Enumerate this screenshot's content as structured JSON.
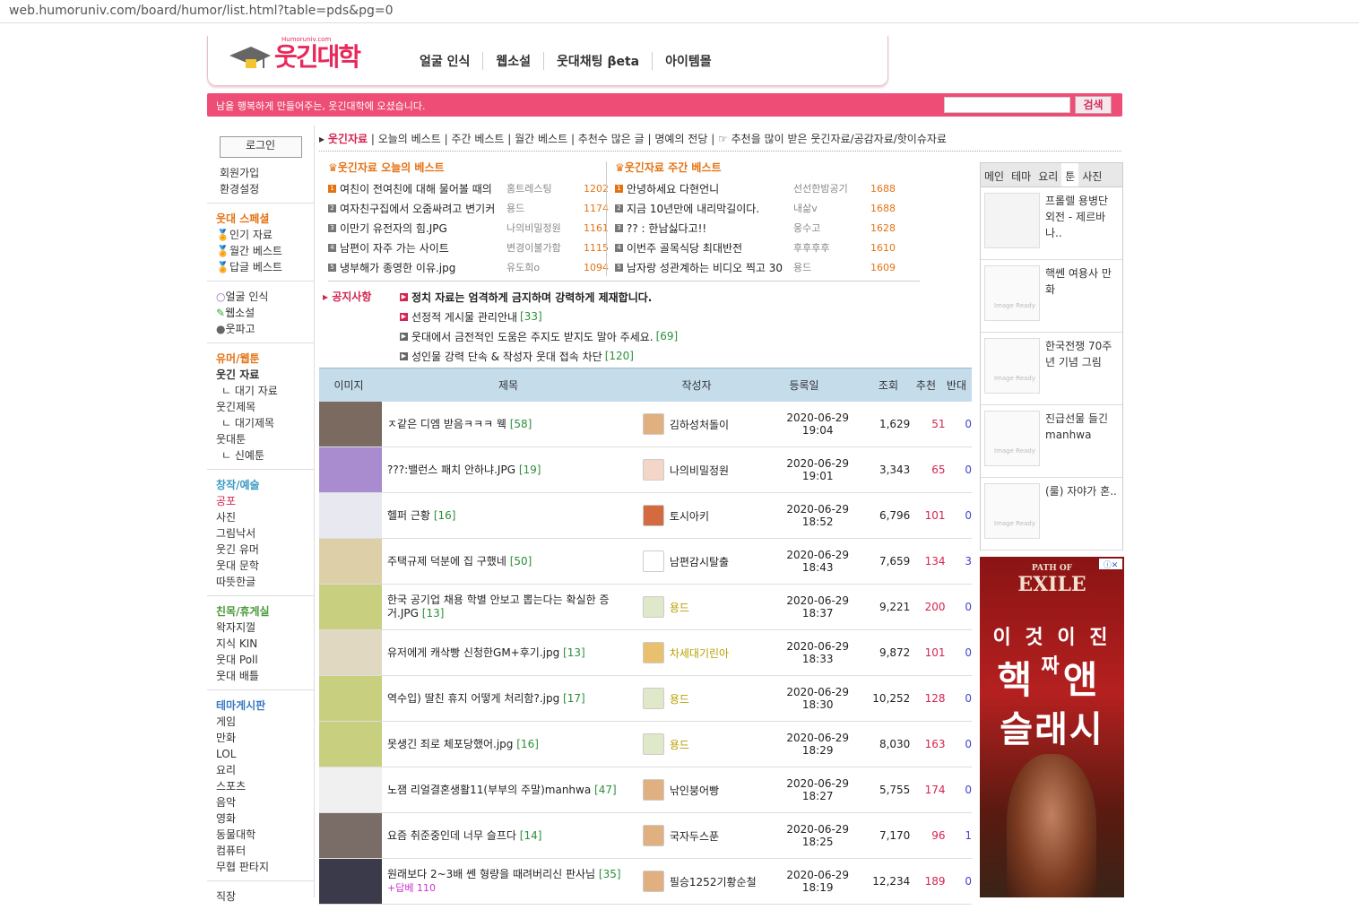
{
  "url": "web.humoruniv.com/board/humor/list.html?table=pds&pg=0",
  "header": {
    "logo_text": "웃긴대학",
    "logo_small": "Humoruniv.com",
    "nav": [
      "얼굴 인식",
      "웹소설",
      "웃대채팅 βeta",
      "아이템몰"
    ]
  },
  "pinkbar": {
    "welcome": "남을 행복하게 만들어주는, 웃긴대학에 오셨습니다.",
    "search_button": "검색"
  },
  "left": {
    "login": "로그인",
    "account": [
      "회원가입",
      "환경설정"
    ],
    "special_title": "웃대 스페셜",
    "special": [
      "인기 자료",
      "월간 베스트",
      "답글 베스트"
    ],
    "tools": [
      "얼굴 인식",
      "웹소설",
      "웃파고"
    ],
    "humor_title": "유머/웹툰",
    "humor": [
      "웃긴 자료",
      "대기 자료",
      "웃긴제목",
      "대기제목",
      "웃대툰",
      "신예툰"
    ],
    "creative_title": "창작/예술",
    "creative": [
      "공포",
      "사진",
      "그림낙서",
      "웃긴 유머",
      "웃대 문학",
      "따뜻한글"
    ],
    "social_title": "친목/휴게실",
    "social": [
      "왁자지껄",
      "지식 KIN",
      "웃대 Poll",
      "웃대 배틀"
    ],
    "theme_title": "테마게시판",
    "theme": [
      "게임",
      "만화",
      "LOL",
      "요리",
      "스포츠",
      "음악",
      "영화",
      "동물대학",
      "컴퓨터",
      "무협 판타지"
    ],
    "last": "직장"
  },
  "subtabs": {
    "active": "웃긴자료",
    "items": [
      "오늘의 베스트",
      "주간 베스트",
      "월간 베스트",
      "추천수 많은 글",
      "명예의 전당"
    ],
    "desc": "추천을 많이 받은 웃긴자료/공감자료/핫이슈자료"
  },
  "today_best": {
    "title": "웃긴자료 오늘의 베스트",
    "rows": [
      {
        "n": "1",
        "t": "여친이 전여친에 대해 물어볼 때의",
        "a": "홈트레스팅",
        "c": "1202"
      },
      {
        "n": "2",
        "t": "여자친구집에서 오줌싸려고 변기커",
        "a": "용드",
        "c": "1174"
      },
      {
        "n": "3",
        "t": "이만기 유전자의 힘.JPG",
        "a": "나의비밀정원",
        "c": "1161"
      },
      {
        "n": "4",
        "t": "남편이 자주 가는 사이트",
        "a": "변경이불가함",
        "c": "1115"
      },
      {
        "n": "5",
        "t": "냉부해가 종영한 이유.jpg",
        "a": "유도희o",
        "c": "1094"
      }
    ]
  },
  "week_best": {
    "title": "웃긴자료 주간 베스트",
    "rows": [
      {
        "n": "1",
        "t": "안녕하세요 다현언니",
        "a": "선선한밤공기",
        "c": "1688"
      },
      {
        "n": "2",
        "t": "지금 10년만에 내리막길이다.",
        "a": "내삶v",
        "c": "1688"
      },
      {
        "n": "3",
        "t": "?? : 한남싫다고!!",
        "a": "웅수고",
        "c": "1628"
      },
      {
        "n": "4",
        "t": "이번주 골목식당 최대반전",
        "a": "후후후후",
        "c": "1610"
      },
      {
        "n": "5",
        "t": "남자랑 성관계하는 비디오 찍고 30",
        "a": "용드",
        "c": "1609"
      }
    ]
  },
  "notice": {
    "label": "공지사항",
    "items": [
      {
        "t": "정치 자료는 엄격하게 금지하며 강력하게 제재합니다.",
        "c": ""
      },
      {
        "t": "선정적 게시물 관리안내",
        "c": "[33]"
      },
      {
        "t": "웃대에서 금전적인 도움은 주지도 받지도 말아 주세요.",
        "c": "[69]"
      },
      {
        "t": "성인물 강력 단속 & 작성자 웃대 접속 차단",
        "c": "[120]"
      }
    ]
  },
  "board": {
    "headers": [
      "이미지",
      "제목",
      "작성자",
      "등록일",
      "조회",
      "추천",
      "반대"
    ],
    "rows": [
      {
        "title": "ㅈ같은 디엠 받음ㅋㅋㅋ 웩",
        "cm": "[58]",
        "writer": "김하성처돌이",
        "date": "2020-06-29",
        "time": "19:04",
        "views": "1,629",
        "rec": "51",
        "opp": "0"
      },
      {
        "title": "???:밸런스 패치 안하냐.JPG",
        "cm": "[19]",
        "writer": "나의비밀정원",
        "date": "2020-06-29",
        "time": "19:01",
        "views": "3,343",
        "rec": "65",
        "opp": "0"
      },
      {
        "title": "헬퍼 근황",
        "cm": "[16]",
        "writer": "토시아키",
        "date": "2020-06-29",
        "time": "18:52",
        "views": "6,796",
        "rec": "101",
        "opp": "0"
      },
      {
        "title": "주택규제 덕분에 집 구했네",
        "cm": "[50]",
        "writer": "남편감시탈출",
        "date": "2020-06-29",
        "time": "18:43",
        "views": "7,659",
        "rec": "134",
        "opp": "3"
      },
      {
        "title": "한국 공기업 채용 학별 안보고 뽑는다는 확실한 증거.JPG",
        "cm": "[13]",
        "writer": "용드",
        "date": "2020-06-29",
        "time": "18:37",
        "views": "9,221",
        "rec": "200",
        "opp": "0"
      },
      {
        "title": "유저에게 캐삭빵 신청한GM+후기.jpg",
        "cm": "[13]",
        "writer": "차세대기린아",
        "date": "2020-06-29",
        "time": "18:33",
        "views": "9,872",
        "rec": "101",
        "opp": "0"
      },
      {
        "title": "역수입) 딸친 휴지 어떻게 처리함?.jpg",
        "cm": "[17]",
        "writer": "용드",
        "date": "2020-06-29",
        "time": "18:30",
        "views": "10,252",
        "rec": "128",
        "opp": "0"
      },
      {
        "title": "못생긴 죄로 체포당했어.jpg",
        "cm": "[16]",
        "writer": "용드",
        "date": "2020-06-29",
        "time": "18:29",
        "views": "8,030",
        "rec": "163",
        "opp": "0"
      },
      {
        "title": "노잼 리얼결혼생활11(부부의 주말)manhwa",
        "cm": "[47]",
        "writer": "낚인붕어빵",
        "date": "2020-06-29",
        "time": "18:27",
        "views": "5,755",
        "rec": "174",
        "opp": "0"
      },
      {
        "title": "요즘 취준중인데 너무 슬프다",
        "cm": "[14]",
        "writer": "국자두스푼",
        "date": "2020-06-29",
        "time": "18:25",
        "views": "7,170",
        "rec": "96",
        "opp": "1"
      },
      {
        "title": "원래보다 2~3배 쎈 형량을 때려버리신 판사님",
        "cm": "[35]",
        "extra": "+답베 110",
        "writer": "필승1252기황순철",
        "date": "2020-06-29",
        "time": "18:19",
        "views": "12,234",
        "rec": "189",
        "opp": "0"
      }
    ]
  },
  "right": {
    "tabs": [
      "메인",
      "테마",
      "요리",
      "툰",
      "사진"
    ],
    "image_ready": "Image Ready",
    "items": [
      "프롤렐 용병단 외전 - 제르바나..",
      "핵쎈 여용사 만화",
      "한국전쟁 70주년 기념 그림",
      "진급선물 들긴 manhwa",
      "(룰) 자야가 혼.."
    ]
  },
  "ad": {
    "brand": "EXILE",
    "brand_small": "PATH OF",
    "line1": "이 것 이 진 짜",
    "line2": "핵 앤",
    "line3": "슬래시"
  }
}
